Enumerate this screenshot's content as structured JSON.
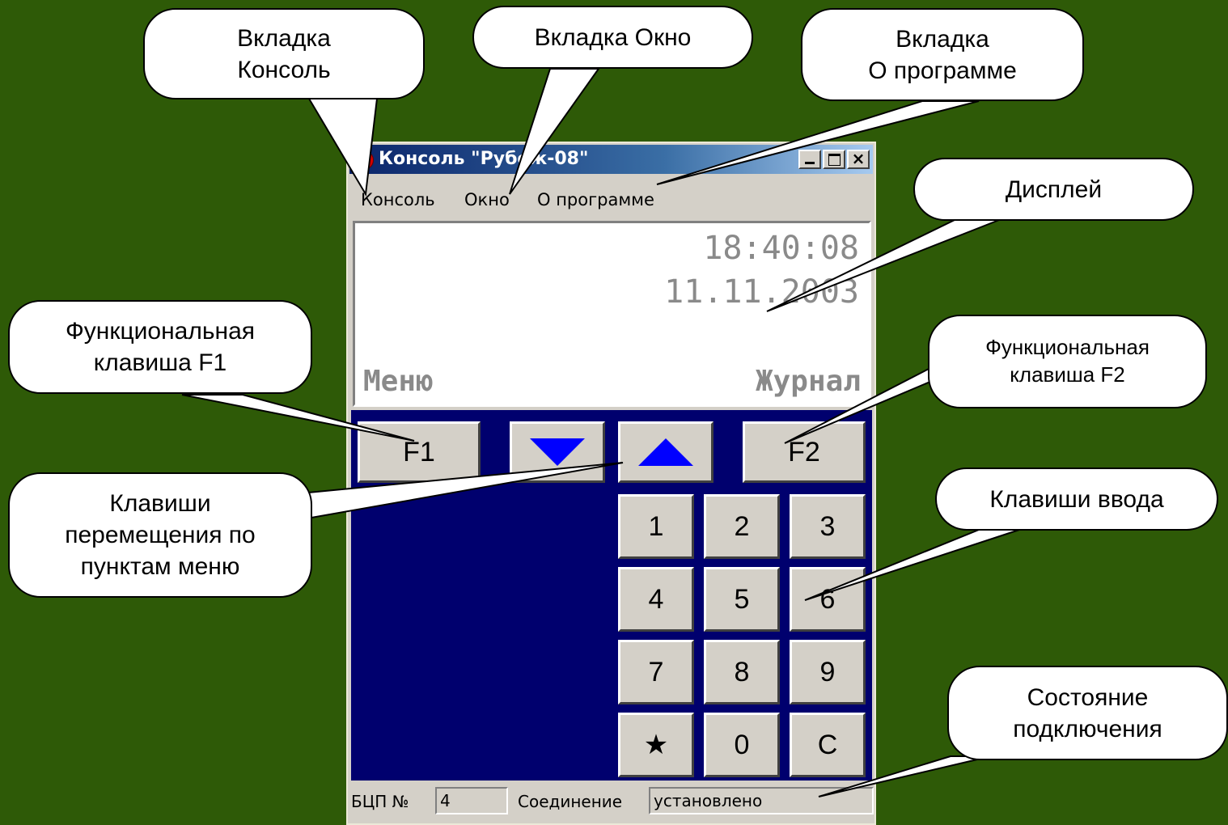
{
  "window": {
    "title": "Консоль \"Рубеж-08\"",
    "controls": {
      "minimize": "_",
      "maximize": "□",
      "close": "×"
    },
    "menu": [
      "Консоль",
      "Окно",
      "О программе"
    ]
  },
  "display": {
    "time": "18:40:08",
    "date": "11.11.2003",
    "soft_left": "Меню",
    "soft_right": "Журнал",
    "text_color": "#8a8a8a"
  },
  "keypad": {
    "f1": "F1",
    "f2": "F2",
    "down_icon": "arrow-down-icon",
    "up_icon": "arrow-up-icon",
    "digits": [
      "1",
      "2",
      "3",
      "4",
      "5",
      "6",
      "7",
      "8",
      "9",
      "★",
      "0",
      "С"
    ],
    "background_color": "#00006e",
    "arrow_color": "#0000ff"
  },
  "status": {
    "bcp_label": "БЦП №",
    "bcp_value": "4",
    "conn_label": "Соединение",
    "conn_value": "установлено"
  },
  "callouts": {
    "tab_console": "Вкладка\nКонсоль",
    "tab_window": "Вкладка Окно",
    "tab_about": "Вкладка\nО программе",
    "display": "Дисплей",
    "f1_key": "Функциональная\nклавиша F1",
    "f2_key": "Функциональная\nклавиша F2",
    "nav_keys": "Клавиши\nперемещения по\nпунктам меню",
    "input_keys": "Клавиши ввода",
    "connection": "Состояние\nподключения"
  },
  "background_color": "#2e5a07"
}
